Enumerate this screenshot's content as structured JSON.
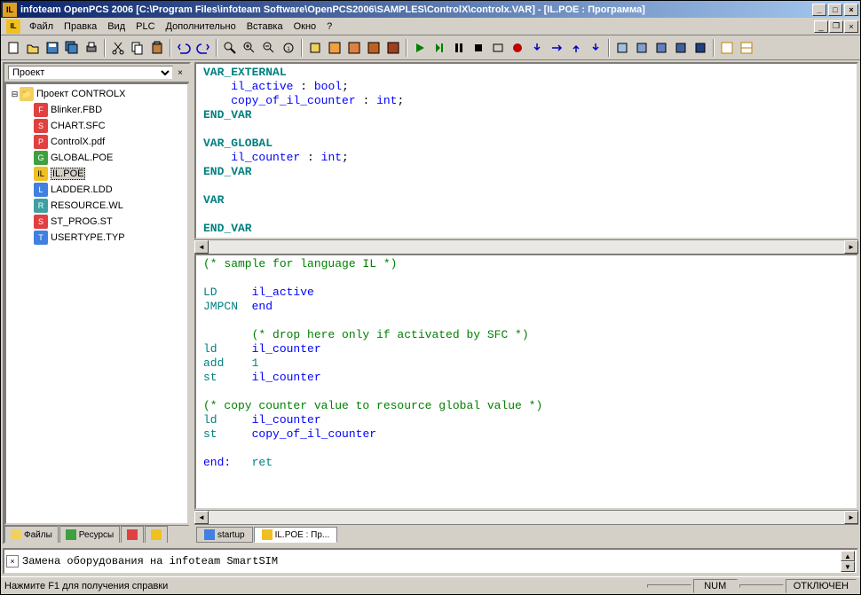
{
  "window": {
    "title": "infoteam OpenPCS 2006 [C:\\Program Files\\infoteam Software\\OpenPCS2006\\SAMPLES\\ControlX\\controlx.VAR]  - [IL.POE : Программа]"
  },
  "menu": {
    "items": [
      "Файл",
      "Правка",
      "Вид",
      "PLC",
      "Дополнительно",
      "Вставка",
      "Окно",
      "?"
    ]
  },
  "sidebar": {
    "dropdown": "Проект",
    "root": "Проект CONTROLX",
    "files": [
      {
        "name": "Blinker.FBD",
        "icon": "fbd"
      },
      {
        "name": "CHART.SFC",
        "icon": "sfc"
      },
      {
        "name": "ControlX.pdf",
        "icon": "pdf"
      },
      {
        "name": "GLOBAL.POE",
        "icon": "poe"
      },
      {
        "name": "IL.POE",
        "icon": "il",
        "selected": true
      },
      {
        "name": "LADDER.LDD",
        "icon": "ldd"
      },
      {
        "name": "RESOURCE.WL",
        "icon": "wl"
      },
      {
        "name": "ST_PROG.ST",
        "icon": "st"
      },
      {
        "name": "USERTYPE.TYP",
        "icon": "typ"
      }
    ],
    "tabs": [
      {
        "label": "Файлы",
        "icon": "files"
      },
      {
        "label": "Ресурсы",
        "icon": "resources"
      },
      {
        "label": "",
        "icon": "lib"
      },
      {
        "label": "",
        "icon": "help"
      }
    ]
  },
  "editor": {
    "top_code": {
      "l1a": "VAR_EXTERNAL",
      "l2a": "il_active",
      "l2b": " : ",
      "l2c": "bool",
      "l2d": ";",
      "l3a": "copy_of_il_counter",
      "l3b": " : ",
      "l3c": "int",
      "l3d": ";",
      "l4a": "END_VAR",
      "l5": "",
      "l6a": "VAR_GLOBAL",
      "l7a": "il_counter",
      "l7b": " : ",
      "l7c": "int",
      "l7d": ";",
      "l8a": "END_VAR",
      "l9": "",
      "l10a": "VAR",
      "l11": "",
      "l12a": "END_VAR"
    },
    "bottom_code": {
      "c1": "(* sample for language IL *)",
      "l1a": "LD",
      "l1b": "il_active",
      "l2a": "JMPCN",
      "l2b": "end",
      "c2": "(* drop here only if activated by SFC *)",
      "l3a": "ld",
      "l3b": "il_counter",
      "l4a": "add",
      "l4b": "1",
      "l5a": "st",
      "l5b": "il_counter",
      "c3": "(* copy counter value to resource global value *)",
      "l6a": "ld",
      "l6b": "il_counter",
      "l7a": "st",
      "l7b": "copy_of_il_counter",
      "l8a": "end:",
      "l8b": "ret"
    },
    "tabs": [
      {
        "label": "startup",
        "active": false
      },
      {
        "label": "IL.POE : Пр...",
        "active": true
      }
    ]
  },
  "output": {
    "message": "Замена оборудования на infoteam SmartSIM"
  },
  "statusbar": {
    "help": "Нажмите F1 для получения справки",
    "num": "NUM",
    "conn": "ОТКЛЮЧЕН"
  }
}
